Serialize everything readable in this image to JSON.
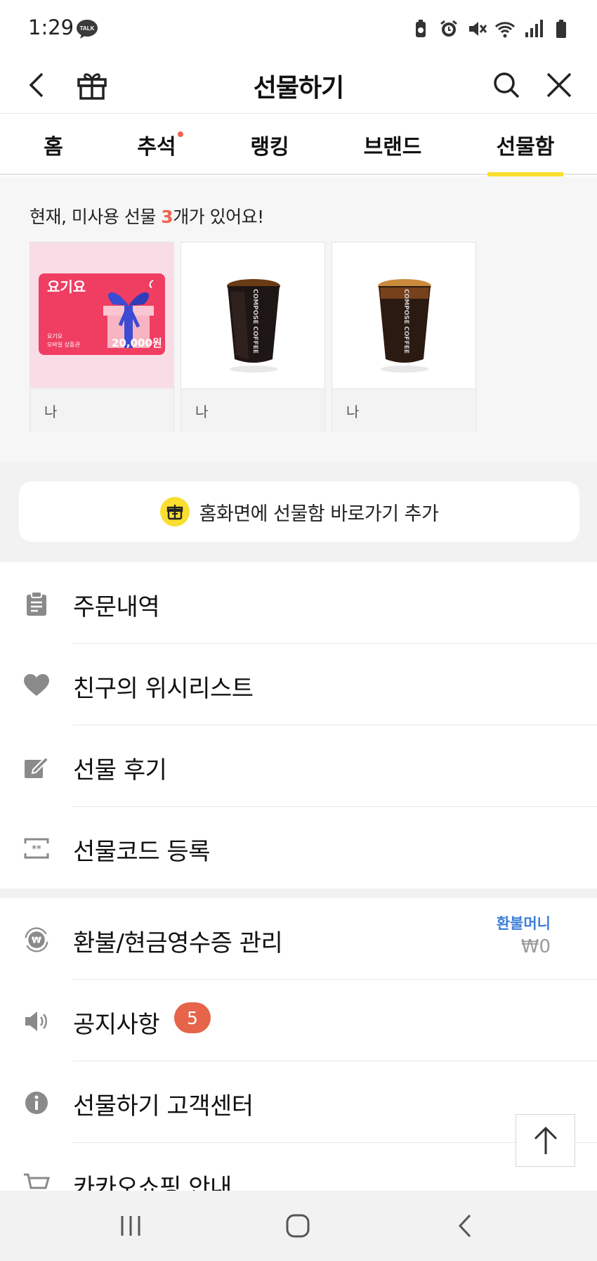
{
  "status_bar": {
    "time": "1:29",
    "talk_badge": "TALK"
  },
  "header": {
    "title": "선물하기"
  },
  "tabs": [
    {
      "label": "홈",
      "active": false,
      "dot": false
    },
    {
      "label": "추석",
      "active": false,
      "dot": true
    },
    {
      "label": "랭킹",
      "active": false,
      "dot": false
    },
    {
      "label": "브랜드",
      "active": false,
      "dot": false
    },
    {
      "label": "선물함",
      "active": true,
      "dot": false
    }
  ],
  "unused": {
    "prefix": "현재, 미사용 선물 ",
    "count": "3",
    "suffix": "개가 있어요!",
    "items": [
      {
        "image": "yogiyo-giftcard",
        "brand": "요기요",
        "card_sub1": "요기요",
        "card_sub2": "모바일 상품권",
        "amount": "20,000원",
        "from": "나"
      },
      {
        "image": "compose-coffee-iced",
        "cup_text": "COMPOSE COFFEE",
        "from": "나"
      },
      {
        "image": "compose-coffee-iced-latte",
        "cup_text": "COMPOSE COFFEE",
        "from": "나"
      }
    ]
  },
  "shortcut": {
    "label": "홈화면에 선물함 바로가기 추가"
  },
  "menu": {
    "group1": [
      {
        "label": "주문내역",
        "icon": "clipboard-icon"
      },
      {
        "label": "친구의 위시리스트",
        "icon": "heart-icon"
      },
      {
        "label": "선물 후기",
        "icon": "edit-icon"
      },
      {
        "label": "선물코드 등록",
        "icon": "code-icon"
      }
    ],
    "group2": [
      {
        "label": "환불/현금영수증 관리",
        "icon": "refund-icon"
      },
      {
        "label": "공지사항",
        "icon": "speaker-icon"
      },
      {
        "label": "선물하기 고객센터",
        "icon": "info-icon"
      },
      {
        "label": "카카오쇼핑 안내",
        "icon": "cart-icon"
      }
    ],
    "refund_label": "환불머니",
    "refund_amount": "₩0",
    "notice_badge": "5"
  },
  "colors": {
    "accent_yellow": "#f9de2f",
    "badge_red": "#e5644a",
    "link_blue": "#3d7fd9"
  }
}
